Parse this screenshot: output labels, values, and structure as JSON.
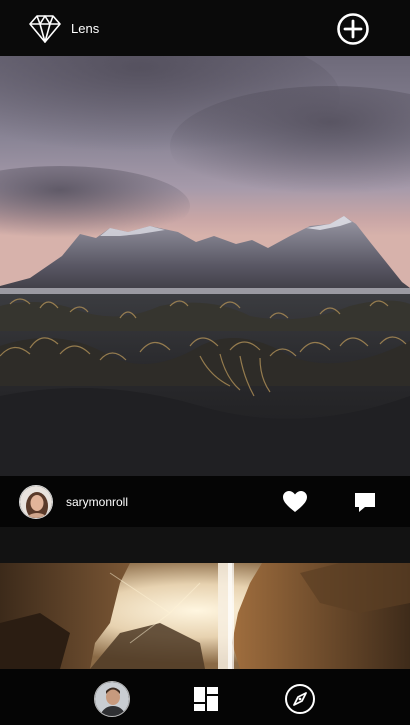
{
  "header": {
    "app_title": "Lens",
    "logo_icon": "diamond-icon",
    "add_icon": "plus-circle-icon"
  },
  "post": {
    "username": "sarymonroll",
    "like_icon": "heart-icon",
    "comment_icon": "comment-icon"
  },
  "bottom_nav": {
    "items": [
      {
        "icon": "profile-avatar"
      },
      {
        "icon": "dashboard-icon"
      },
      {
        "icon": "compass-icon"
      }
    ]
  }
}
